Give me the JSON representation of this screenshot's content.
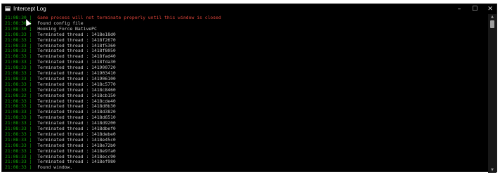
{
  "window": {
    "title": "Intercept Log",
    "controls": {
      "minimize": "–",
      "maximize": "☐",
      "close": "✕"
    }
  },
  "scrollbar": {
    "up_glyph": "▲",
    "down_glyph": "▼"
  },
  "log": [
    {
      "time": "21:08:30",
      "text": "Game process will not terminate properly until this window is closed",
      "level": "error"
    },
    {
      "time": "21:08:30",
      "text": "Found config file",
      "level": "info"
    },
    {
      "time": "21:08:30",
      "text": "Hooking Force NativePC",
      "level": "info"
    },
    {
      "time": "21:08:33",
      "text": "Terminated thread : 1418e18d0",
      "level": "info"
    },
    {
      "time": "21:08:33",
      "text": "Terminated thread : 1418f2670",
      "level": "info"
    },
    {
      "time": "21:08:33",
      "text": "Terminated thread : 1418f5360",
      "level": "info"
    },
    {
      "time": "21:08:33",
      "text": "Terminated thread : 1418f8050",
      "level": "info"
    },
    {
      "time": "21:08:33",
      "text": "Terminated thread : 1418fad40",
      "level": "info"
    },
    {
      "time": "21:08:33",
      "text": "Terminated thread : 1418fda30",
      "level": "info"
    },
    {
      "time": "21:08:33",
      "text": "Terminated thread : 141900720",
      "level": "info"
    },
    {
      "time": "21:08:33",
      "text": "Terminated thread : 141903410",
      "level": "info"
    },
    {
      "time": "21:08:33",
      "text": "Terminated thread : 141906100",
      "level": "info"
    },
    {
      "time": "21:08:33",
      "text": "Terminated thread : 1418c5770",
      "level": "info"
    },
    {
      "time": "21:08:33",
      "text": "Terminated thread : 1418c8460",
      "level": "info"
    },
    {
      "time": "21:08:32",
      "text": "Terminated thread : 1418cb150",
      "level": "info"
    },
    {
      "time": "21:08:33",
      "text": "Terminated thread : 1418cde40",
      "level": "info"
    },
    {
      "time": "21:08:33",
      "text": "Terminated thread : 1418d0b30",
      "level": "info"
    },
    {
      "time": "21:08:33",
      "text": "Terminated thread : 1418d3820",
      "level": "info"
    },
    {
      "time": "21:08:33",
      "text": "Terminated thread : 1418d6510",
      "level": "info"
    },
    {
      "time": "21:08:33",
      "text": "Terminated thread : 1418d9200",
      "level": "info"
    },
    {
      "time": "21:08:33",
      "text": "Terminated thread : 1418dbef0",
      "level": "info"
    },
    {
      "time": "21:08:33",
      "text": "Terminated thread : 1418debe0",
      "level": "info"
    },
    {
      "time": "21:08:33",
      "text": "Terminated thread : 1418e45c0",
      "level": "info"
    },
    {
      "time": "21:08:33",
      "text": "Terminated thread : 1418e72b0",
      "level": "info"
    },
    {
      "time": "21:08:33",
      "text": "Terminated thread : 1418e9fa0",
      "level": "info"
    },
    {
      "time": "21:08:33",
      "text": "Terminated thread : 1418ecc90",
      "level": "info"
    },
    {
      "time": "21:08:33",
      "text": "Terminated thread : 1418ef980",
      "level": "info"
    },
    {
      "time": "21:08:33",
      "text": "Found window.",
      "level": "info"
    }
  ],
  "colors": {
    "background": "#000000",
    "timestamp": "#14a90a",
    "message": "#c8c8c8",
    "error": "#e0443a"
  }
}
